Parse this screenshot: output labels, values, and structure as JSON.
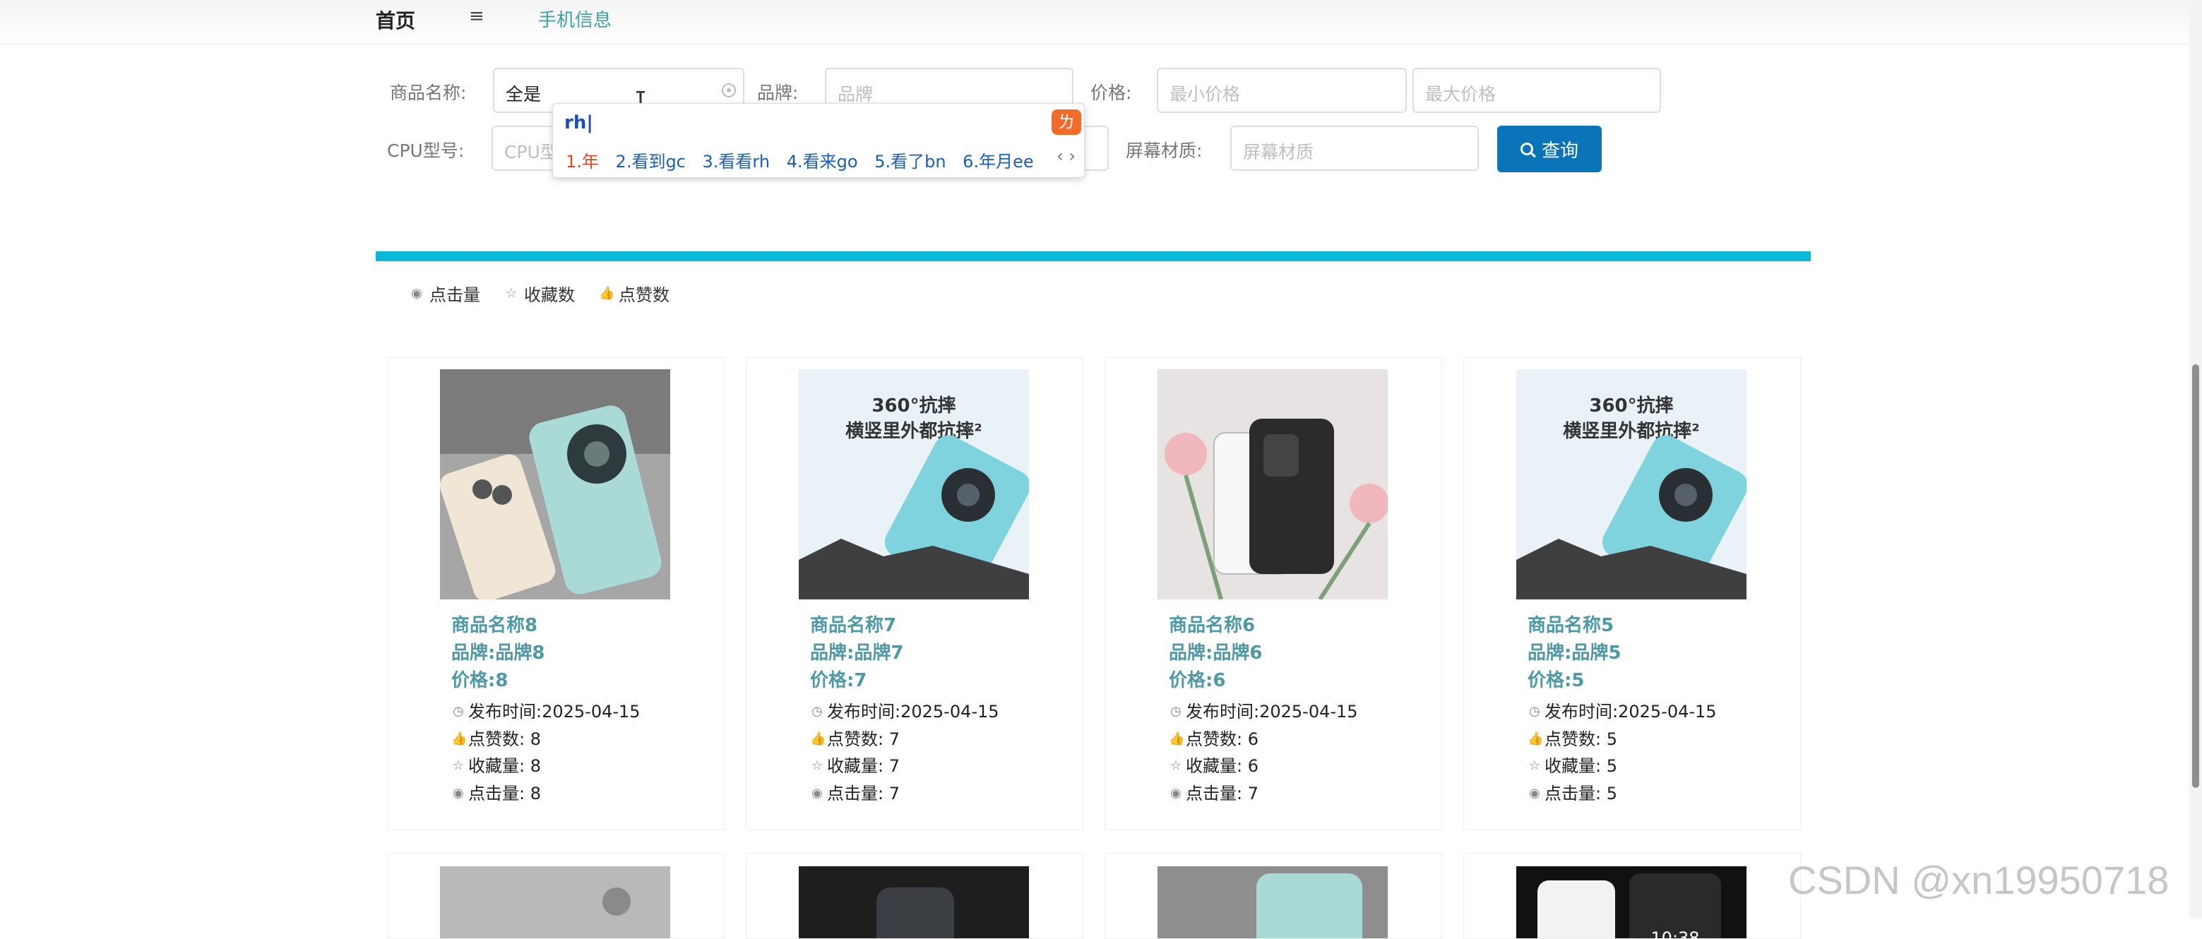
{
  "nav": {
    "home": "首页",
    "menu_icon": "≡",
    "phone_info": "手机信息"
  },
  "search": {
    "name_label": "商品名称:",
    "name_value": "全是",
    "brand_label": "品牌:",
    "brand_placeholder": "品牌",
    "price_label": "价格:",
    "min_price_placeholder": "最小价格",
    "max_price_placeholder": "最大价格",
    "cpu_label": "CPU型号:",
    "cpu_placeholder": "CPU型",
    "screen_label": "屏幕材质:",
    "screen_placeholder": "屏幕材质",
    "query_button": "查询"
  },
  "ime": {
    "composition": "rh|",
    "candidates": [
      "1.年",
      "2.看到gc",
      "3.看看rh",
      "4.看来go",
      "5.看了bn",
      "6.年月ee"
    ],
    "nav": "‹ ›"
  },
  "sort": {
    "clicks": "点击量",
    "favorites": "收藏数",
    "likes": "点赞数"
  },
  "products": [
    {
      "name": "商品名称8",
      "brand": "品牌:品牌8",
      "price": "价格:8",
      "date": "发布时间:2025-04-15",
      "likes": "点赞数: 8",
      "favs": "收藏量: 8",
      "clicks": "点击量: 8",
      "image": "phones-pair-light"
    },
    {
      "name": "商品名称7",
      "brand": "品牌:品牌7",
      "price": "价格:7",
      "date": "发布时间:2025-04-15",
      "likes": "点赞数: 7",
      "favs": "收藏量: 7",
      "clicks": "点击量: 7",
      "image": "phone-ad-blue"
    },
    {
      "name": "商品名称6",
      "brand": "品牌:品牌6",
      "price": "价格:6",
      "date": "发布时间:2025-04-15",
      "likes": "点赞数: 6",
      "favs": "收藏量: 6",
      "clicks": "点击量: 7",
      "image": "phones-flowers"
    },
    {
      "name": "商品名称5",
      "brand": "品牌:品牌5",
      "price": "价格:5",
      "date": "发布时间:2025-04-15",
      "likes": "点赞数: 5",
      "favs": "收藏量: 5",
      "clicks": "点击量: 5",
      "image": "phone-ad-blue"
    }
  ],
  "ad_text": {
    "line1": "360°抗摔",
    "line2": "横竖里外都抗摔²"
  },
  "second_row_clock": "10:38",
  "watermark": "CSDN @xn19950718",
  "colors": {
    "accent": "#0bb7d6",
    "button": "#0b74b8",
    "title": "#4d9aa6",
    "ime_logo": "#f36a2a"
  }
}
